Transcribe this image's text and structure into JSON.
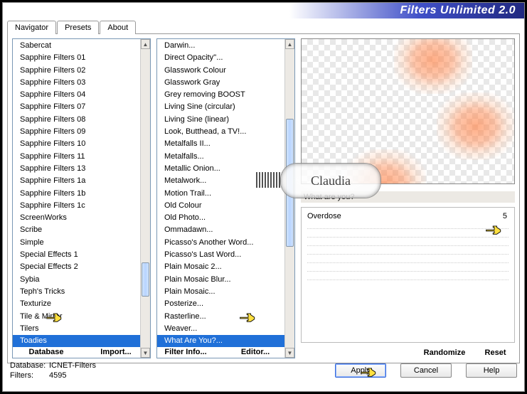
{
  "header": {
    "title": "Filters Unlimited 2.0"
  },
  "tabs": [
    "Navigator",
    "Presets",
    "About"
  ],
  "active_tab": 0,
  "list1": [
    "Sabercat",
    "Sapphire Filters 01",
    "Sapphire Filters 02",
    "Sapphire Filters 03",
    "Sapphire Filters 04",
    "Sapphire Filters 07",
    "Sapphire Filters 08",
    "Sapphire Filters 09",
    "Sapphire Filters 10",
    "Sapphire Filters 11",
    "Sapphire Filters 13",
    "Sapphire Filters 1a",
    "Sapphire Filters 1b",
    "Sapphire Filters 1c",
    "ScreenWorks",
    "Scribe",
    "Simple",
    "Special Effects 1",
    "Special Effects 2",
    "Sybia",
    "Teph's Tricks",
    "Texturize",
    "Tile & Mirror",
    "Tilers",
    "Toadies"
  ],
  "list1_selected": 24,
  "list2": [
    "Darwin...",
    "Direct Opacity''...",
    "Glasswork Colour",
    "Glasswork Gray",
    "Grey removing BOOST",
    "Living Sine (circular)",
    "Living Sine (linear)",
    "Look, Butthead, a TV!...",
    "Metalfalls II...",
    "Metalfalls...",
    "Metallic Onion...",
    "Metalwork...",
    "Motion Trail...",
    "Old Colour",
    "Old Photo...",
    "Ommadawn...",
    "Picasso's Another Word...",
    "Picasso's Last Word...",
    "Plain Mosaic 2...",
    "Plain Mosaic Blur...",
    "Plain Mosaic...",
    "Posterize...",
    "Rasterline...",
    "Weaver...",
    "What Are You?..."
  ],
  "list2_selected": 24,
  "left_buttons": [
    "Database",
    "Import...",
    "Filter Info...",
    "Editor..."
  ],
  "filter_name": "What are you?",
  "params": [
    {
      "name": "Overdose",
      "value": "5"
    }
  ],
  "right_buttons": [
    "Randomize",
    "Reset"
  ],
  "bottom": {
    "db_label": "Database:",
    "db_value": "ICNET-Filters",
    "filters_label": "Filters:",
    "filters_value": "4595",
    "apply": "Apply",
    "cancel": "Cancel",
    "help": "Help"
  },
  "watermark": "Claudia"
}
